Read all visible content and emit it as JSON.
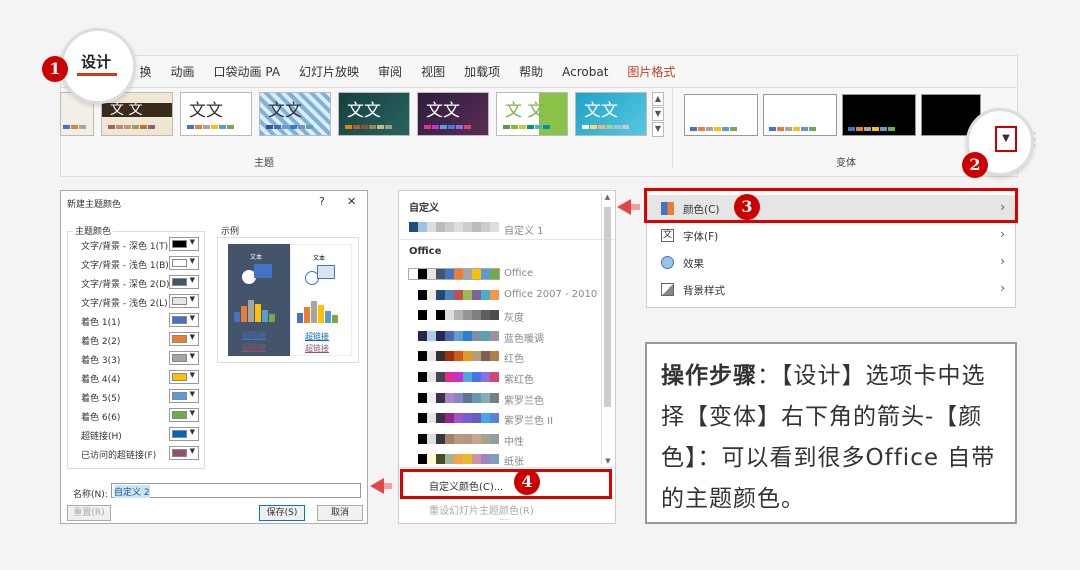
{
  "ribbon": {
    "tab_active": "设计",
    "tabs": [
      "换",
      "动画",
      "口袋动画 PA",
      "幻灯片放映",
      "审阅",
      "视图",
      "加载项",
      "帮助",
      "Acrobat",
      "图片格式"
    ],
    "group_themes": "主题",
    "group_variants": "变体",
    "theme_text": "文文",
    "theme_text_alt": "文 文"
  },
  "badges": {
    "one": "1",
    "two": "2",
    "three": "3",
    "four": "4"
  },
  "dialog": {
    "title": "新建主题颜色",
    "help": "?",
    "close": "✕",
    "group_label": "主题颜色",
    "sample_label": "示例",
    "items": [
      {
        "label": "文字/背景 - 深色 1(T)",
        "color": "#000000"
      },
      {
        "label": "文字/背景 - 浅色 1(B)",
        "color": "#ffffff"
      },
      {
        "label": "文字/背景 - 深色 2(D)",
        "color": "#44546a"
      },
      {
        "label": "文字/背景 - 浅色 2(L)",
        "color": "#e7e6e6"
      },
      {
        "label": "着色 1(1)",
        "color": "#4472c4"
      },
      {
        "label": "着色 2(2)",
        "color": "#ed7d31"
      },
      {
        "label": "着色 3(3)",
        "color": "#a5a5a5"
      },
      {
        "label": "着色 4(4)",
        "color": "#ffc000"
      },
      {
        "label": "着色 5(5)",
        "color": "#5b9bd5"
      },
      {
        "label": "着色 6(6)",
        "color": "#70ad47"
      },
      {
        "label": "超链接(H)",
        "color": "#0563c1"
      },
      {
        "label": "已访问的超链接(F)",
        "color": "#954f72"
      }
    ],
    "sample_text": "文本",
    "sample_link1": "超链接",
    "sample_link2": "超链接",
    "name_label": "名称(N):",
    "name_value": "自定义 2",
    "reset_button": "重置(R)",
    "save_button": "保存(S)",
    "cancel_button": "取消"
  },
  "colorlist": {
    "custom_header": "自定义",
    "custom_item": "自定义 1",
    "office_header": "Office",
    "palettes": [
      {
        "name": "Office",
        "colors": [
          "#ffffff",
          "#000000",
          "#e7e6e6",
          "#44546a",
          "#4472c4",
          "#ed7d31",
          "#a5a5a5",
          "#ffc000",
          "#5b9bd5",
          "#70ad47"
        ]
      },
      {
        "name": "Office 2007 - 2010",
        "colors": [
          "#ffffff",
          "#000000",
          "#eeece1",
          "#1f497d",
          "#4f81bd",
          "#c0504d",
          "#9bbb59",
          "#8064a2",
          "#4bacc6",
          "#f79646"
        ]
      },
      {
        "name": "灰度",
        "colors": [
          "#ffffff",
          "#000000",
          "#f8f8f8",
          "#000000",
          "#dddddd",
          "#b2b2b2",
          "#969696",
          "#808080",
          "#5f5f5f",
          "#4d4d4d"
        ]
      },
      {
        "name": "蓝色暖调",
        "colors": [
          "#ffffff",
          "#242852",
          "#acccea",
          "#242852",
          "#4a66ac",
          "#629dd1",
          "#297fd5",
          "#7f8fa9",
          "#5aa2ae",
          "#9d90a0"
        ]
      },
      {
        "name": "红色",
        "colors": [
          "#ffffff",
          "#000000",
          "#e8e8e8",
          "#323232",
          "#a5300f",
          "#d55816",
          "#e19825",
          "#b19c7d",
          "#7f5f52",
          "#b27d49"
        ]
      },
      {
        "name": "紫红色",
        "colors": [
          "#ffffff",
          "#000000",
          "#e7e6e6",
          "#454551",
          "#e32d91",
          "#c830cc",
          "#4ea6dc",
          "#4775e7",
          "#8971e1",
          "#d54773"
        ]
      },
      {
        "name": "紫罗兰色",
        "colors": [
          "#ffffff",
          "#000000",
          "#f0ecf4",
          "#373545",
          "#ad84c6",
          "#8784c7",
          "#5d739a",
          "#6997af",
          "#84acb6",
          "#6f8183"
        ]
      },
      {
        "name": "紫罗兰色 II",
        "colors": [
          "#ffffff",
          "#000000",
          "#e7e6e6",
          "#373545",
          "#92278f",
          "#9b57d3",
          "#755dd9",
          "#665eb8",
          "#45a5ed",
          "#5982db"
        ]
      },
      {
        "name": "中性",
        "colors": [
          "#ffffff",
          "#000000",
          "#dcdee0",
          "#373545",
          "#a2836e",
          "#bc9a7b",
          "#b7957c",
          "#c5a694",
          "#a8a28c",
          "#919e9f"
        ]
      },
      {
        "name": "纸张",
        "colors": [
          "#ffffff",
          "#000000",
          "#fefac9",
          "#444d26",
          "#a5b592",
          "#f3a447",
          "#e7bc29",
          "#d092a7",
          "#9c85c0",
          "#809ec2"
        ]
      }
    ],
    "custom_colors_item": "自定义颜色(C)...",
    "reset_item": "重设幻灯片主题颜色(R)",
    "ellipsis": "....",
    "scroll_up": "▲",
    "scroll_down": "▼"
  },
  "menu": {
    "items": [
      {
        "label": "颜色(C)",
        "icon": "color-icon"
      },
      {
        "label": "字体(F)",
        "icon": "font-icon"
      },
      {
        "label": "效果",
        "icon": "effects-icon"
      },
      {
        "label": "背景样式",
        "icon": "background-icon"
      }
    ],
    "arrow": "›"
  },
  "info": {
    "bold": "操作步骤",
    "text": "：【设计】选项卡中选择【变体】右下角的箭头-【颜色】：可以看到很多Office 自带的主题颜色。"
  },
  "colors": {
    "accent_red": "#c00000",
    "ppt_orange": "#c43e1c"
  }
}
